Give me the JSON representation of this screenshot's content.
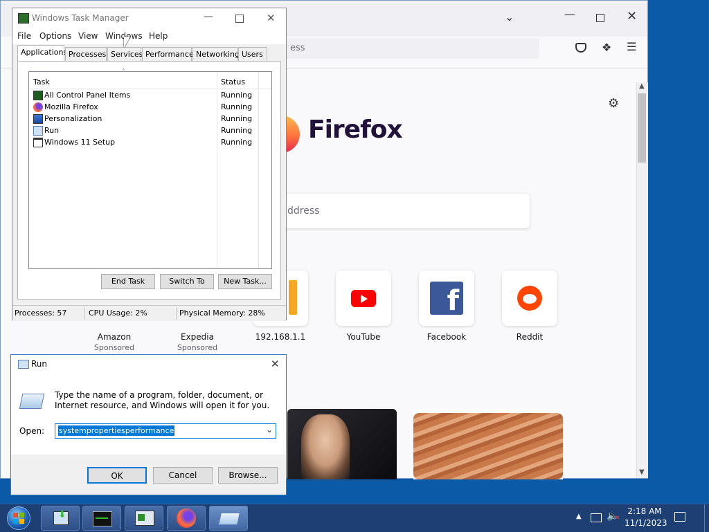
{
  "firefox": {
    "url_placeholder_partial": "ess",
    "logo_text": "Firefox",
    "search_placeholder_partial": "ddress",
    "shortcuts": [
      {
        "label": "Amazon",
        "sub": "Sponsored"
      },
      {
        "label": "Expedia",
        "sub": "Sponsored"
      },
      {
        "label": "192.168.1.1",
        "sub": ""
      },
      {
        "label": "YouTube",
        "sub": ""
      },
      {
        "label": "Facebook",
        "sub": ""
      },
      {
        "label": "Reddit",
        "sub": ""
      }
    ],
    "colors": {
      "youtube": "#ff0000",
      "facebook": "#3b5998",
      "reddit": "#ff4500"
    }
  },
  "task_manager": {
    "title": "Windows Task Manager",
    "menu": [
      "File",
      "Options",
      "View",
      "Windows",
      "Help"
    ],
    "tabs": [
      "Applications",
      "Processes",
      "Services",
      "Performance",
      "Networking",
      "Users"
    ],
    "columns": {
      "task": "Task",
      "status": "Status"
    },
    "rows": [
      {
        "task": "All Control Panel Items",
        "status": "Running",
        "icon": "control-panel-icon"
      },
      {
        "task": "Mozilla Firefox",
        "status": "Running",
        "icon": "firefox-icon"
      },
      {
        "task": "Personalization",
        "status": "Running",
        "icon": "personalization-icon"
      },
      {
        "task": "Run",
        "status": "Running",
        "icon": "run-icon"
      },
      {
        "task": "Windows 11 Setup",
        "status": "Running",
        "icon": "setup-window-icon"
      }
    ],
    "buttons": {
      "end_task": "End Task",
      "switch_to": "Switch To",
      "new_task": "New Task..."
    },
    "status": {
      "processes": "Processes: 57",
      "cpu": "CPU Usage: 2%",
      "memory": "Physical Memory: 28%"
    }
  },
  "run_dialog": {
    "title": "Run",
    "description": "Type the name of a program, folder, document, or Internet resource, and Windows will open it for you.",
    "open_label": "Open:",
    "input_value": "systempropertiesperformance",
    "buttons": {
      "ok": "OK",
      "cancel": "Cancel",
      "browse": "Browse..."
    }
  },
  "taskbar": {
    "time": "2:18 AM",
    "date": "11/1/2023"
  }
}
